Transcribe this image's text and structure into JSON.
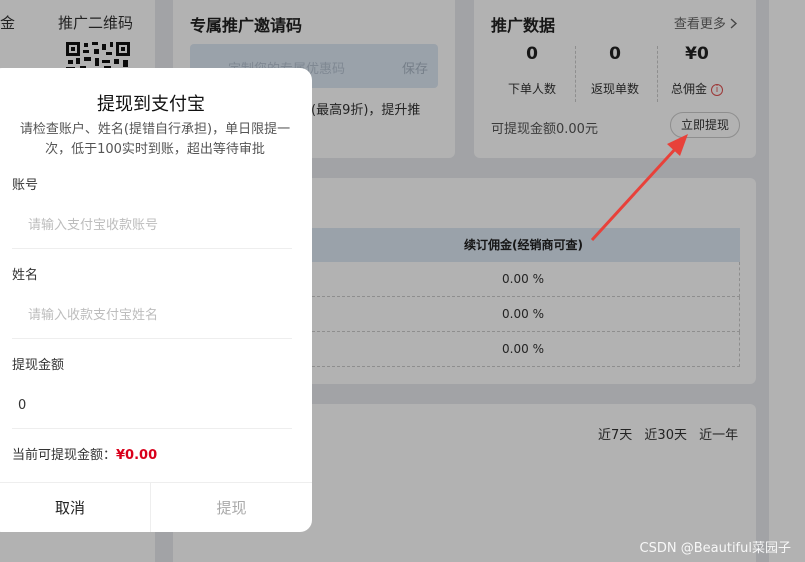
{
  "qr_section": {
    "left_title": "金",
    "title": "推广二维码"
  },
  "invite": {
    "title": "专属推广邀请码",
    "placeholder": "定制您的专属优惠码",
    "save_label": "保存",
    "desc": "(最高9折)，提升推"
  },
  "stats": {
    "title": "推广数据",
    "more_label": "查看更多",
    "items": [
      {
        "value": "0",
        "label": "下单人数"
      },
      {
        "value": "0",
        "label": "返现单数"
      },
      {
        "value": "¥0",
        "label": "总佣金"
      }
    ],
    "available_text": "可提现金额0.00元",
    "withdraw_button": "立即提现"
  },
  "commission_table": {
    "header": "续订佣金(经销商可查)",
    "rows": [
      "0.00 %",
      "0.00 %",
      "0.00 %"
    ]
  },
  "time_ranges": [
    "近7天",
    "近30天",
    "近一年"
  ],
  "dialog": {
    "title": "提现到支付宝",
    "notice": "请检查账户、姓名(提错自行承担)，单日限提一次，低于100实时到账，超出等待审批",
    "account_label": "账号",
    "account_placeholder": "请输入支付宝收款账号",
    "name_label": "姓名",
    "name_placeholder": "请输入收款支付宝姓名",
    "amount_label": "提现金额",
    "amount_value": "0",
    "current_label": "当前可提现金额：",
    "current_amount": "¥0.00",
    "cancel_label": "取消",
    "submit_label": "提现"
  },
  "watermark": "CSDN @Beautiful菜园子",
  "colors": {
    "accent_red": "#d9001b",
    "arrow_red": "#e8413a",
    "header_blue": "#dde8f4"
  }
}
